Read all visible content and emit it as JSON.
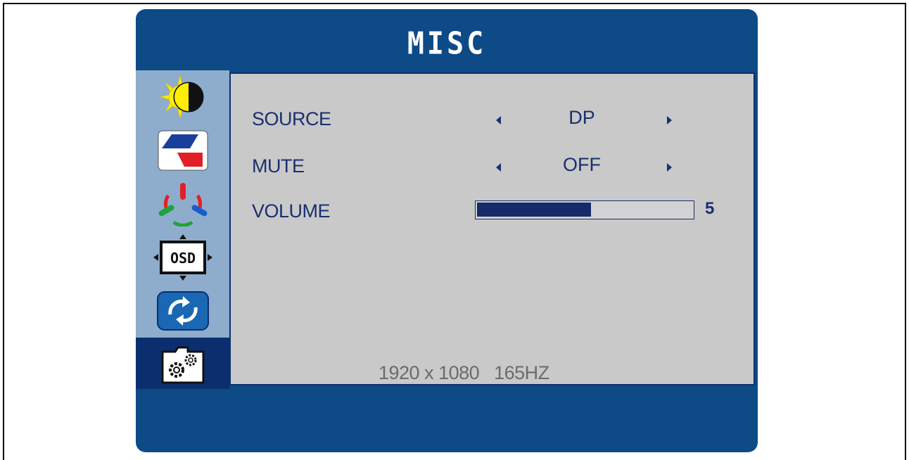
{
  "osd": {
    "title": "MISC",
    "sidebar": [
      {
        "icon": "brightness-contrast-icon",
        "active": false
      },
      {
        "icon": "image-icon",
        "active": false
      },
      {
        "icon": "color-rgb-icon",
        "active": false
      },
      {
        "icon": "osd-position-icon",
        "label": "OSD",
        "active": false
      },
      {
        "icon": "reset-icon",
        "active": false
      },
      {
        "icon": "settings-gears-icon",
        "active": true
      }
    ],
    "rows": [
      {
        "label": "SOURCE",
        "value": "DP"
      },
      {
        "label": "MUTE",
        "value": "OFF"
      },
      {
        "label": "VOLUME",
        "value": "5",
        "level_percent": 53
      }
    ],
    "resolution": "1920 x 1080   165HZ"
  },
  "colors": {
    "frame": "#0d4a86",
    "sidebar": "#8eadcd",
    "active": "#0b2f6e",
    "content": "#c9c9c9",
    "text": "#1a2f6e"
  }
}
